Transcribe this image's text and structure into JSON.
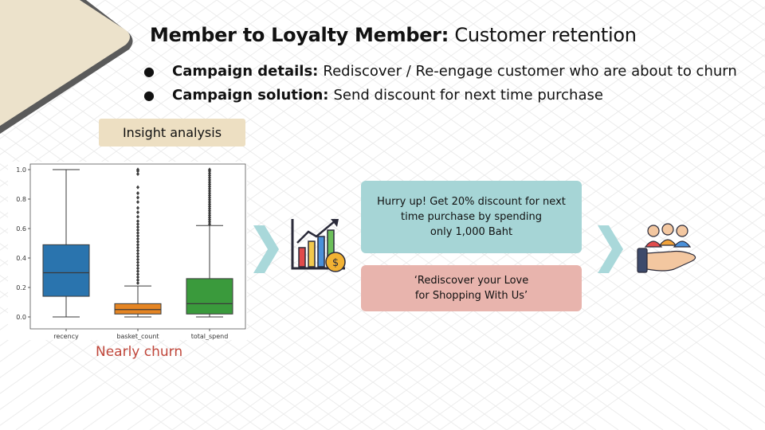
{
  "slide": {
    "title_bold": "Member to Loyalty Member:",
    "title_rest": "Customer retention",
    "bullets": [
      {
        "bold": "Campaign details:",
        "text": "Rediscover / Re-engage customer who are about to churn"
      },
      {
        "bold": "Campaign solution:",
        "text": "Send discount for next time purchase"
      }
    ],
    "insight_label": "Insight analysis",
    "chart_caption": "Nearly churn",
    "offer_card": "Hurry up! Get 20% discount for next\ntime purchase by spending\nonly 1,000 Baht",
    "slogan_card": "‘Rediscover your Love\nfor Shopping With Us’",
    "icons": [
      "chevron-right-icon",
      "growth-chart-icon",
      "chevron-right-icon",
      "customers-in-hand-icon"
    ]
  },
  "colors": {
    "title_accent": "#e9dcbc",
    "card_teal": "#a6d5d6",
    "card_pink": "#e8b4ad",
    "caption_red": "#c0463a",
    "chevron": "#a9d8da"
  },
  "chart_data": {
    "type": "boxplot",
    "categories": [
      "recency",
      "basket_count",
      "total_spend"
    ],
    "ylim": [
      0.0,
      1.0
    ],
    "yticks": [
      "0.0",
      "0.2",
      "0.4",
      "0.6",
      "0.8",
      "1.0"
    ],
    "series": [
      {
        "category": "recency",
        "color": "#2a74ae",
        "whisker_low": 0.0,
        "q1": 0.14,
        "median": 0.3,
        "q3": 0.49,
        "whisker_high": 1.0,
        "outliers": []
      },
      {
        "category": "basket_count",
        "color": "#e58523",
        "whisker_low": 0.0,
        "q1": 0.02,
        "median": 0.05,
        "q3": 0.09,
        "whisker_high": 0.21,
        "outliers": [
          0.23,
          0.25,
          0.27,
          0.29,
          0.31,
          0.33,
          0.35,
          0.37,
          0.39,
          0.41,
          0.43,
          0.45,
          0.47,
          0.49,
          0.51,
          0.53,
          0.55,
          0.57,
          0.59,
          0.61,
          0.63,
          0.65,
          0.68,
          0.71,
          0.74,
          0.78,
          0.81,
          0.84,
          0.88,
          0.97,
          0.99,
          1.0
        ]
      },
      {
        "category": "total_spend",
        "color": "#3a9a3c",
        "whisker_low": 0.0,
        "q1": 0.02,
        "median": 0.09,
        "q3": 0.26,
        "whisker_high": 0.62,
        "outliers": [
          0.63,
          0.645,
          0.66,
          0.675,
          0.69,
          0.705,
          0.72,
          0.735,
          0.75,
          0.765,
          0.78,
          0.795,
          0.81,
          0.825,
          0.84,
          0.855,
          0.87,
          0.885,
          0.9,
          0.915,
          0.93,
          0.945,
          0.96,
          0.975,
          0.99,
          1.0
        ]
      }
    ],
    "title": "",
    "xlabel": "",
    "ylabel": "",
    "grid": false,
    "legend": "none"
  }
}
